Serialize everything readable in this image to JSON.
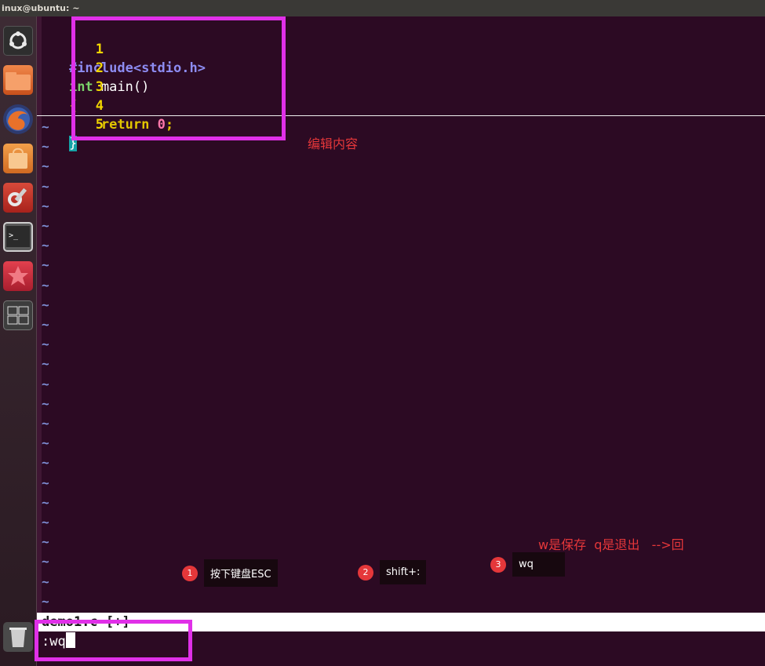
{
  "window": {
    "title": "inux@ubuntu: ~"
  },
  "launcher": {
    "items": [
      {
        "name": "ubuntu-logo-icon",
        "color": "#2f2f2f"
      },
      {
        "name": "files-icon",
        "color": "#e46c2c"
      },
      {
        "name": "firefox-icon",
        "color": "#d9561f"
      },
      {
        "name": "software-center-icon",
        "color": "#e08a32"
      },
      {
        "name": "settings-icon",
        "color": "#c9322a"
      },
      {
        "name": "terminal-icon",
        "color": "#2d2d2d"
      },
      {
        "name": "app-icon",
        "color": "#c72f3f"
      },
      {
        "name": "workspace-switcher-icon",
        "color": "#3b3b3b"
      },
      {
        "name": "trash-icon",
        "color": "#8e8e8e"
      }
    ]
  },
  "editor": {
    "lines": [
      {
        "num": "1",
        "directive": "#include",
        "header": "<stdio.h>"
      },
      {
        "num": "2",
        "type": "int",
        "rest": " main()"
      },
      {
        "num": "3",
        "brace": "{"
      },
      {
        "num": "4",
        "indent": "    ",
        "keyword": "return",
        "space": " ",
        "value": "0",
        "semicolon": ";"
      },
      {
        "num": "5",
        "brace": "}"
      }
    ],
    "tilde": "~",
    "status": "demo1.c [+]",
    "command": ":wq"
  },
  "annotations": {
    "edit_label": "编辑内容",
    "save_quit_note": "w是保存  q是退出   -->回",
    "steps": [
      {
        "num": "1",
        "text": "按下键盘ESC"
      },
      {
        "num": "2",
        "text": "shift+:"
      },
      {
        "num": "3",
        "text": "wq"
      }
    ]
  },
  "colors": {
    "highlight_box": "#e030e8",
    "annotation_red": "#e5373a",
    "terminal_bg": "#2c0a23"
  }
}
